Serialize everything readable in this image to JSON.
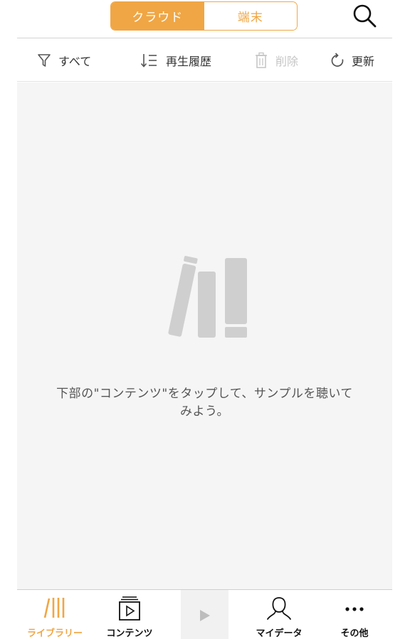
{
  "header": {
    "segments": [
      "クラウド",
      "端末"
    ],
    "active_segment": "クラウド",
    "search_icon": "search-icon"
  },
  "toolbar": {
    "filter_label": "すべて",
    "sort_label": "再生履歴",
    "delete_label": "削除",
    "refresh_label": "更新",
    "delete_enabled": false
  },
  "empty_state": {
    "icon": "books-icon",
    "line1": "下部の\"コンテンツ\"をタップして、サンプルを聴いて",
    "line2": "みよう。"
  },
  "tabs": [
    {
      "label": "ライブラリー",
      "icon": "library-icon",
      "active": true
    },
    {
      "label": "コンテンツ",
      "icon": "contents-icon",
      "active": false
    },
    {
      "label": "",
      "icon": "play-icon",
      "active": false
    },
    {
      "label": "マイデータ",
      "icon": "person-icon",
      "active": false
    },
    {
      "label": "その他",
      "icon": "more-icon",
      "active": false
    }
  ],
  "colors": {
    "accent": "#f0a644",
    "background": "#f5f5f5",
    "disabled": "#c6c6c6"
  }
}
